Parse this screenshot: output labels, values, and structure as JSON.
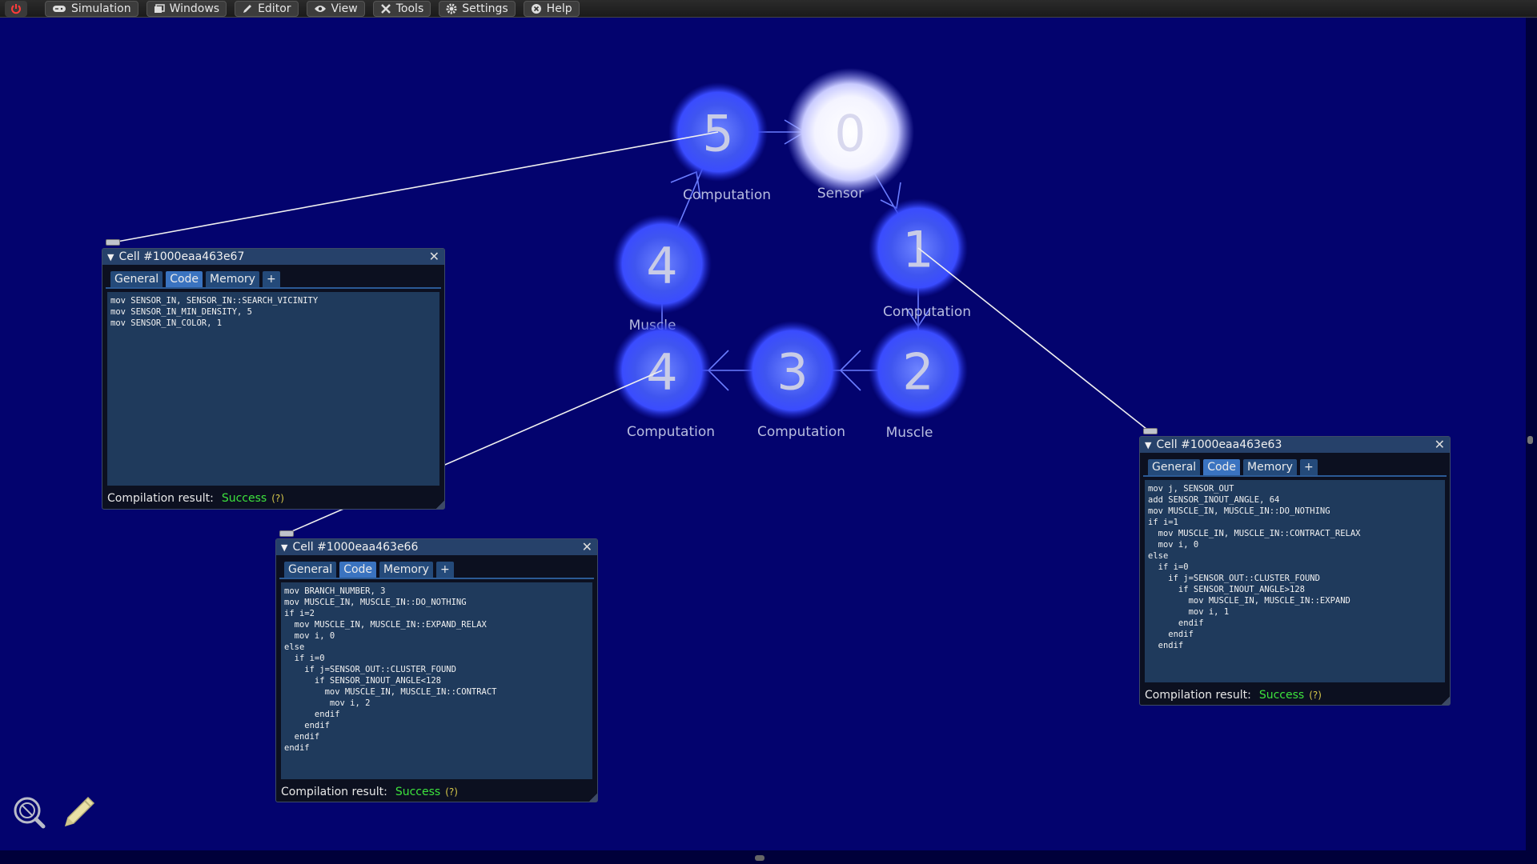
{
  "menu": {
    "items": [
      {
        "label": "Simulation",
        "icon": "gamepad-icon"
      },
      {
        "label": "Windows",
        "icon": "windows-icon"
      },
      {
        "label": "Editor",
        "icon": "pencil-icon"
      },
      {
        "label": "View",
        "icon": "eye-icon"
      },
      {
        "label": "Tools",
        "icon": "tools-icon"
      },
      {
        "label": "Settings",
        "icon": "gear-icon"
      },
      {
        "label": "Help",
        "icon": "help-icon"
      }
    ]
  },
  "cells": [
    {
      "id": "n5",
      "number": "5",
      "label": "Computation"
    },
    {
      "id": "n0",
      "number": "0",
      "label": "Sensor"
    },
    {
      "id": "n1",
      "number": "1",
      "label": "Computation"
    },
    {
      "id": "n4a",
      "number": "4",
      "label": "Muscle"
    },
    {
      "id": "n4b",
      "number": "4",
      "label": "Computation"
    },
    {
      "id": "n3",
      "number": "3",
      "label": "Computation"
    },
    {
      "id": "n2",
      "number": "2",
      "label": "Muscle"
    }
  ],
  "windows": {
    "w67": {
      "title": "Cell #1000eaa463e67",
      "tabs": [
        "General",
        "Code",
        "Memory",
        "+"
      ],
      "code": "mov SENSOR_IN, SENSOR_IN::SEARCH_VICINITY\nmov SENSOR_IN_MIN_DENSITY, 5\nmov SENSOR_IN_COLOR, 1",
      "result_label": "Compilation result:",
      "result_value": "Success",
      "help": "(?)"
    },
    "w66": {
      "title": "Cell #1000eaa463e66",
      "tabs": [
        "General",
        "Code",
        "Memory",
        "+"
      ],
      "code": "mov BRANCH_NUMBER, 3\nmov MUSCLE_IN, MUSCLE_IN::DO_NOTHING\nif i=2\n  mov MUSCLE_IN, MUSCLE_IN::EXPAND_RELAX\n  mov i, 0\nelse\n  if i=0\n    if j=SENSOR_OUT::CLUSTER_FOUND\n      if SENSOR_INOUT_ANGLE<128\n        mov MUSCLE_IN, MUSCLE_IN::CONTRACT\n         mov i, 2\n      endif\n    endif\n  endif\nendif",
      "result_label": "Compilation result:",
      "result_value": "Success",
      "help": "(?)"
    },
    "w63": {
      "title": "Cell #1000eaa463e63",
      "tabs": [
        "General",
        "Code",
        "Memory",
        "+"
      ],
      "code": "mov j, SENSOR_OUT\nadd SENSOR_INOUT_ANGLE, 64\nmov MUSCLE_IN, MUSCLE_IN::DO_NOTHING\nif i=1\n  mov MUSCLE_IN, MUSCLE_IN::CONTRACT_RELAX\n  mov i, 0\nelse\n  if i=0\n    if j=SENSOR_OUT::CLUSTER_FOUND\n      if SENSOR_INOUT_ANGLE>128\n        mov MUSCLE_IN, MUSCLE_IN::EXPAND\n        mov i, 1\n      endif\n    endif\n  endif",
      "result_label": "Compilation result:",
      "result_value": "Success",
      "help": "(?)"
    }
  },
  "tools": {
    "inspect": "inspect-search-icon",
    "edit": "pencil-icon"
  }
}
